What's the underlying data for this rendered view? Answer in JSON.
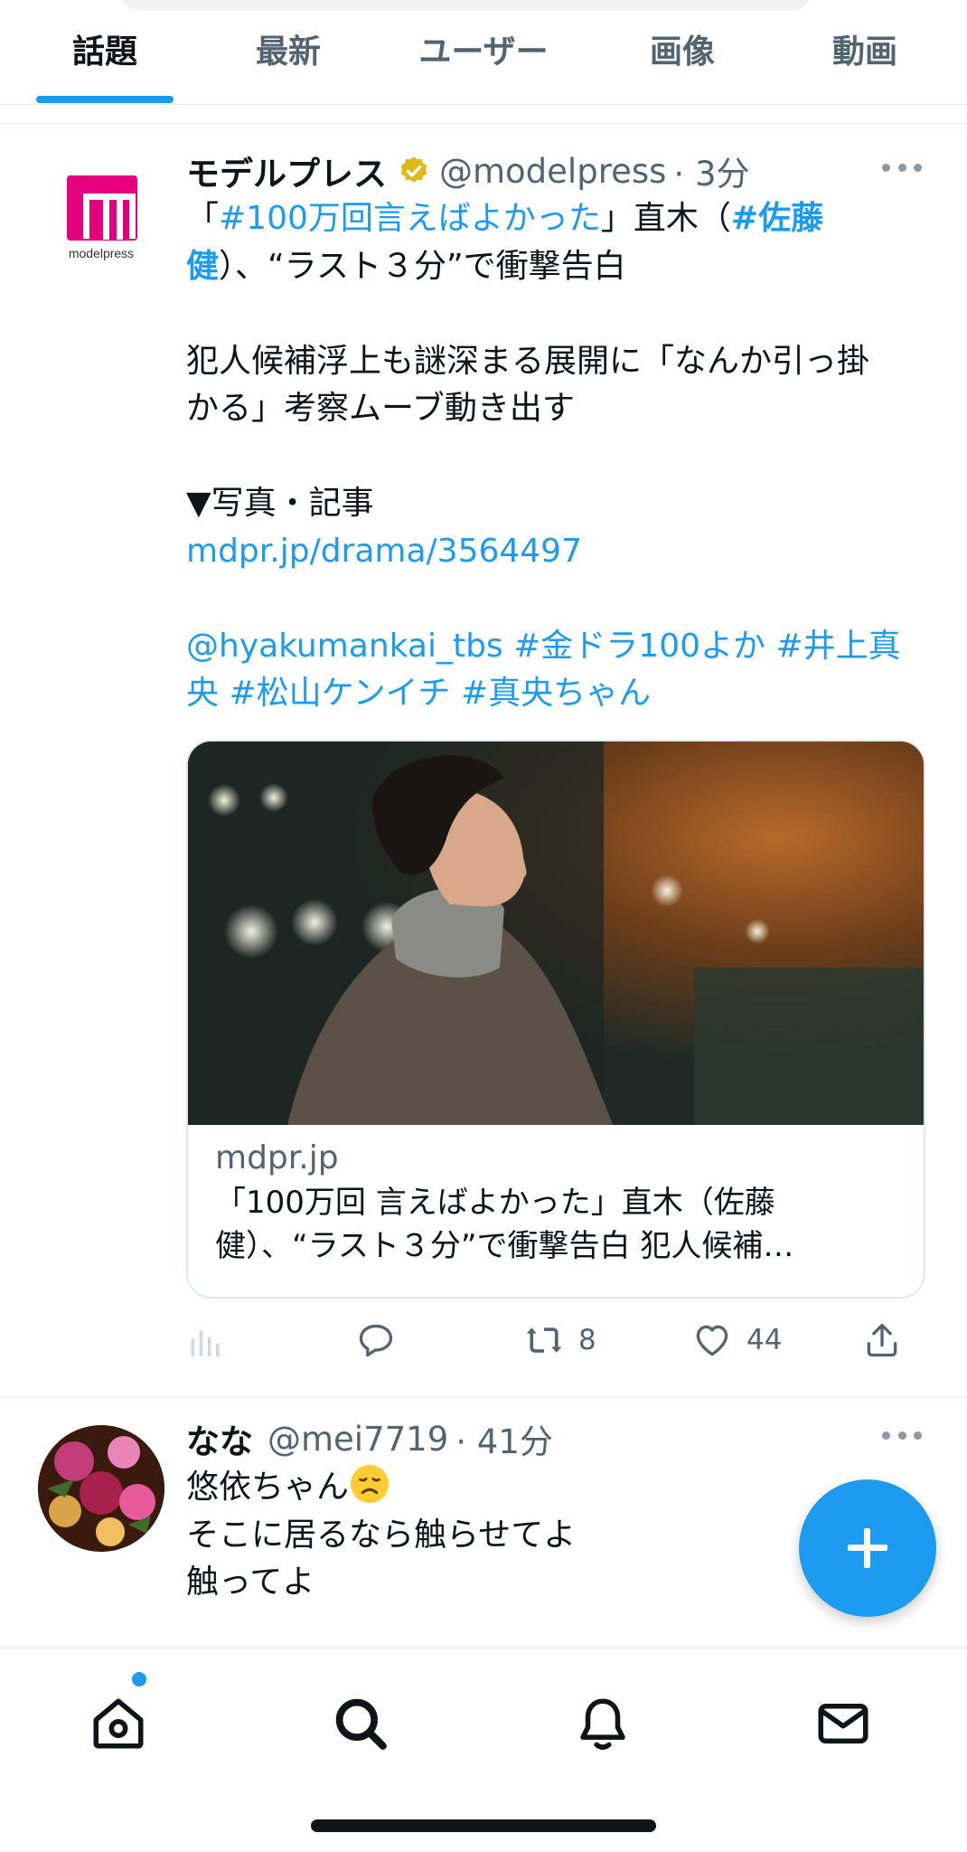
{
  "tabs": [
    {
      "label": "話題",
      "active": true
    },
    {
      "label": "最新",
      "active": false
    },
    {
      "label": "ユーザー",
      "active": false
    },
    {
      "label": "画像",
      "active": false
    },
    {
      "label": "動画",
      "active": false
    }
  ],
  "tweets": [
    {
      "avatar_text": "modelpress",
      "display_name": "モデルプレス",
      "verified_icon": "verified-badge-gold",
      "handle": "@modelpress",
      "time": "· 3分",
      "text": {
        "l1_a": "「",
        "l1_tag": "#100万回言えばよかった",
        "l1_b": "」直木（",
        "l1_tag2": "#佐藤",
        "l2_tag": "健",
        "l2_b": "）、“ラスト３分”で衝撃告白",
        "para2": "犯人候補浮上も謎深まる展開に「なんか引っ掛\nかる」考察ムーブ動き出す",
        "para3": "▼写真・記事",
        "url": "mdpr.jp/drama/3564497",
        "mentions_l1": "@hyakumankai_tbs #金ドラ100よか #井上真",
        "mentions_l2": "央 #松山ケンイチ #真央ちゃん"
      },
      "card": {
        "domain": "mdpr.jp",
        "title": "「100万回 言えばよかった」直木（佐藤\n健）、“ラスト３分”で衝撃告白 犯人候補…"
      },
      "actions": {
        "views_icon": "analytics-icon",
        "reply_icon": "reply-icon",
        "retweet_icon": "retweet-icon",
        "retweet_count": "8",
        "like_icon": "heart-icon",
        "like_count": "44",
        "share_icon": "share-icon"
      }
    },
    {
      "display_name": "なな",
      "handle": "@mei7719",
      "time": "· 41分",
      "text": {
        "l1": "悠依ちゃん",
        "l2": "そこに居るなら触らせてよ",
        "l3": "触ってよ"
      }
    }
  ],
  "fab_icon": "plus-icon",
  "bottom_nav": [
    "home-icon",
    "search-icon",
    "bell-icon",
    "mail-icon"
  ],
  "colors": {
    "accent": "#1d9bf0",
    "text": "#0f1419",
    "secondary": "#536471",
    "brand_modelpress": "#e5007e"
  }
}
